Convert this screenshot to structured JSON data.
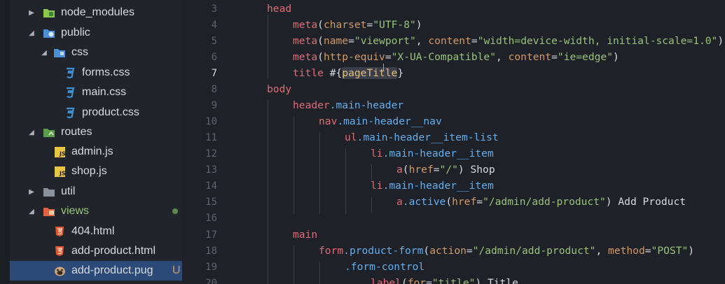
{
  "sidebar": {
    "items": [
      {
        "label": "node_modules",
        "kind": "folder",
        "icon": "node-modules-folder-icon",
        "arrow": "collapsed",
        "depth": 0
      },
      {
        "label": "public",
        "kind": "folder",
        "icon": "public-folder-icon",
        "arrow": "expanded",
        "depth": 0
      },
      {
        "label": "css",
        "kind": "folder",
        "icon": "css-folder-icon",
        "arrow": "expanded",
        "depth": 1
      },
      {
        "label": "forms.css",
        "kind": "file",
        "icon": "css-file-icon",
        "depth": 2
      },
      {
        "label": "main.css",
        "kind": "file",
        "icon": "css-file-icon",
        "depth": 2
      },
      {
        "label": "product.css",
        "kind": "file",
        "icon": "css-file-icon",
        "depth": 2
      },
      {
        "label": "routes",
        "kind": "folder",
        "icon": "routes-folder-icon",
        "arrow": "expanded",
        "depth": 0
      },
      {
        "label": "admin.js",
        "kind": "file",
        "icon": "js-file-icon",
        "depth": 1
      },
      {
        "label": "shop.js",
        "kind": "file",
        "icon": "js-file-icon",
        "depth": 1
      },
      {
        "label": "util",
        "kind": "folder",
        "icon": "util-folder-icon",
        "arrow": "collapsed",
        "depth": 0
      },
      {
        "label": "views",
        "kind": "folder",
        "icon": "views-folder-icon",
        "arrow": "expanded",
        "depth": 0,
        "modified": true
      },
      {
        "label": "404.html",
        "kind": "file",
        "icon": "html-file-icon",
        "depth": 1
      },
      {
        "label": "add-product.html",
        "kind": "file",
        "icon": "html-file-icon",
        "depth": 1
      },
      {
        "label": "add-product.pug",
        "kind": "file",
        "icon": "pug-file-icon",
        "depth": 1,
        "selected": true,
        "git_status": "U"
      }
    ]
  },
  "editor": {
    "current_line": 7,
    "lines": [
      {
        "num": "3",
        "text": "head"
      },
      {
        "num": "4",
        "text": "meta(charset=\"UTF-8\")"
      },
      {
        "num": "5",
        "text": "meta(name=\"viewport\", content=\"width=device-width, initial-scale=1.0\")"
      },
      {
        "num": "6",
        "text": "meta(http-equiv=\"X-UA-Compatible\", content=\"ie=edge\")"
      },
      {
        "num": "7",
        "text": "title #{pageTitle}"
      },
      {
        "num": "8",
        "text": "body"
      },
      {
        "num": "9",
        "text": "header.main-header"
      },
      {
        "num": "10",
        "text": "nav.main-header__nav"
      },
      {
        "num": "11",
        "text": "ul.main-header__item-list"
      },
      {
        "num": "12",
        "text": "li.main-header__item"
      },
      {
        "num": "13",
        "text": "a(href=\"/\") Shop"
      },
      {
        "num": "14",
        "text": "li.main-header__item"
      },
      {
        "num": "15",
        "text": "a.active(href=\"/admin/add-product\") Add Product"
      },
      {
        "num": "16",
        "text": ""
      },
      {
        "num": "17",
        "text": "main"
      },
      {
        "num": "18",
        "text": "form.product-form(action=\"/admin/add-product\", method=\"POST\")"
      },
      {
        "num": "19",
        "text": ".form-control"
      },
      {
        "num": "20",
        "text": "label(for=\"title\") Title"
      }
    ]
  },
  "colors": {
    "sidebar_bg": "#21252b",
    "editor_bg": "#1e2127",
    "selection": "#2c4a78",
    "tag": "#e06c75",
    "class": "#61afef",
    "function": "#e5c07b",
    "attribute": "#d19a66",
    "string": "#98c379",
    "git_untracked": "#d19a66",
    "git_modified_dot": "#5c8a4f"
  }
}
